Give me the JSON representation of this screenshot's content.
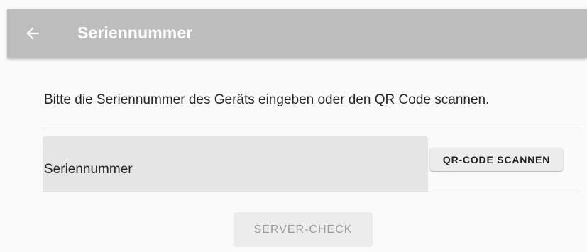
{
  "appbar": {
    "title": "Seriennummer",
    "back_icon": "arrow-left-icon",
    "background": "#bdbdbd"
  },
  "main": {
    "instruction": "Bitte die Seriennummer des Geräts eingeben oder den QR Code scannen.",
    "serial_field": {
      "label": "Seriennummer",
      "value": ""
    },
    "qr_button_label": "QR-CODE SCANNEN",
    "server_check_label": "SERVER-CHECK"
  }
}
